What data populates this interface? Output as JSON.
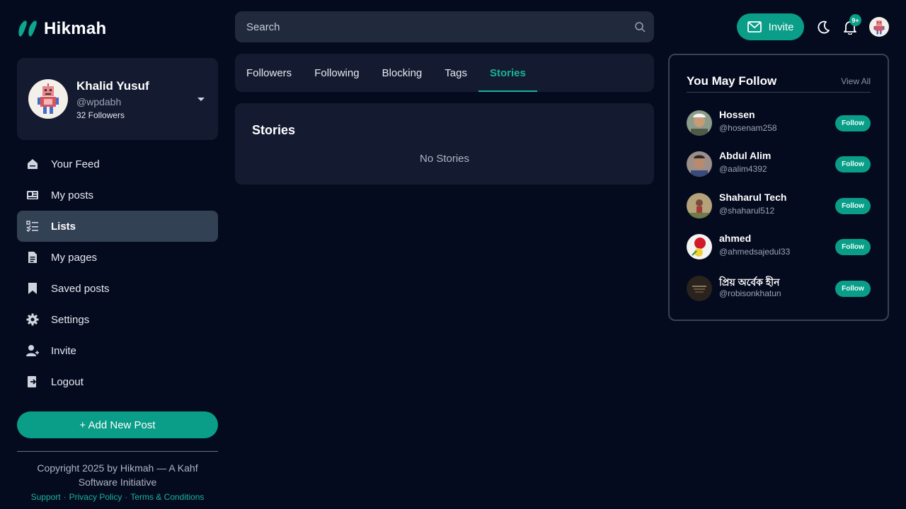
{
  "brand": {
    "name": "Hikmah"
  },
  "profile": {
    "name": "Khalid Yusuf",
    "handle": "@wpdabh",
    "followers": "32 Followers"
  },
  "nav": {
    "items": [
      {
        "label": "Your Feed",
        "icon": "home-icon"
      },
      {
        "label": "My posts",
        "icon": "newspaper-icon"
      },
      {
        "label": "Lists",
        "icon": "checklist-icon",
        "active": true
      },
      {
        "label": "My pages",
        "icon": "document-icon"
      },
      {
        "label": "Saved posts",
        "icon": "bookmark-icon"
      },
      {
        "label": "Settings",
        "icon": "gear-icon"
      },
      {
        "label": "Invite",
        "icon": "user-plus-icon"
      },
      {
        "label": "Logout",
        "icon": "logout-icon"
      }
    ]
  },
  "add_post_label": "+ Add New Post",
  "footer": {
    "copyright": "Copyright 2025 by Hikmah — A Kahf Software Initiative",
    "links": [
      "Support",
      "Privacy Policy",
      "Terms & Conditions"
    ]
  },
  "search": {
    "placeholder": "Search"
  },
  "tabs": [
    {
      "label": "Followers"
    },
    {
      "label": "Following"
    },
    {
      "label": "Blocking"
    },
    {
      "label": "Tags"
    },
    {
      "label": "Stories",
      "active": true
    }
  ],
  "stories": {
    "title": "Stories",
    "empty": "No Stories"
  },
  "header": {
    "invite_label": "Invite",
    "notification_badge": "9+"
  },
  "suggestions": {
    "title": "You May Follow",
    "view_all": "View All",
    "follow_label": "Follow",
    "users": [
      {
        "name": "Hossen",
        "handle": "@hosenam258"
      },
      {
        "name": "Abdul Alim",
        "handle": "@aalim4392"
      },
      {
        "name": "Shaharul Tech",
        "handle": "@shaharul512"
      },
      {
        "name": "ahmed",
        "handle": "@ahmedsajedul33"
      },
      {
        "name": "প্রিয় অর্বেক হীন",
        "handle": "@robisonkhatun"
      }
    ]
  },
  "colors": {
    "accent": "#0a9d87",
    "background": "#050b1f",
    "card": "#141b30",
    "active_nav": "#334155"
  }
}
